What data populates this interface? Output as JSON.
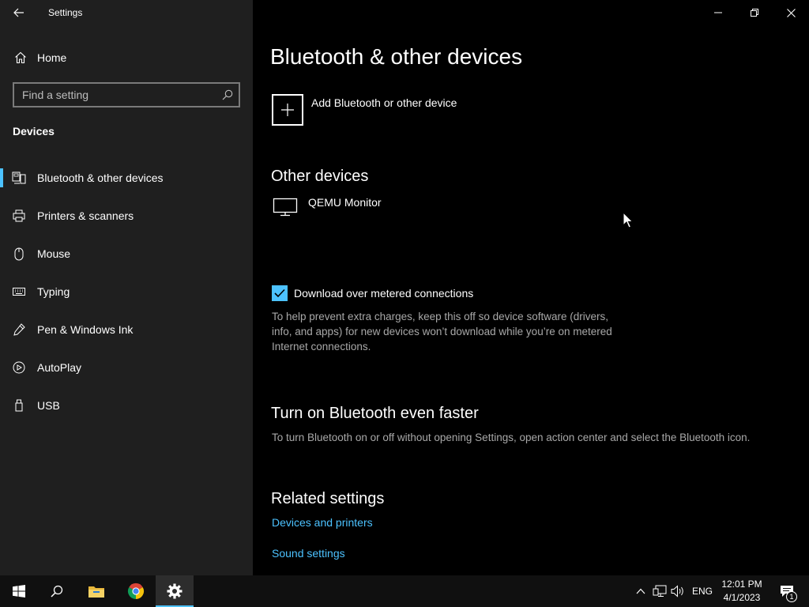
{
  "window": {
    "app_title": "Settings"
  },
  "sidebar": {
    "home_label": "Home",
    "search": {
      "placeholder": "Find a setting",
      "value": ""
    },
    "section_title": "Devices",
    "items": [
      {
        "label": "Bluetooth & other devices",
        "icon": "bluetooth-device-icon",
        "active": true
      },
      {
        "label": "Printers & scanners",
        "icon": "printer-icon"
      },
      {
        "label": "Mouse",
        "icon": "mouse-icon"
      },
      {
        "label": "Typing",
        "icon": "keyboard-icon"
      },
      {
        "label": "Pen & Windows Ink",
        "icon": "pen-icon"
      },
      {
        "label": "AutoPlay",
        "icon": "autoplay-icon"
      },
      {
        "label": "USB",
        "icon": "usb-icon"
      }
    ]
  },
  "main": {
    "title": "Bluetooth & other devices",
    "add_device_label": "Add Bluetooth or other device",
    "other_devices": {
      "heading": "Other devices",
      "devices": [
        {
          "name": "QEMU Monitor",
          "icon": "monitor-icon"
        }
      ]
    },
    "metered": {
      "label": "Download over metered connections",
      "checked": true,
      "description": "To help prevent extra charges, keep this off so device software (drivers, info, and apps) for new devices won’t download while you’re on metered Internet connections."
    },
    "faster": {
      "heading": "Turn on Bluetooth even faster",
      "description": "To turn Bluetooth on or off without opening Settings, open action center and select the Bluetooth icon."
    },
    "related": {
      "heading": "Related settings",
      "links": [
        "Devices and printers",
        "Sound settings"
      ]
    }
  },
  "taskbar": {
    "apps": [
      "start-icon",
      "search-icon",
      "file-explorer-icon",
      "chrome-icon",
      "settings-icon"
    ],
    "language": "ENG",
    "time": "12:01 PM",
    "date": "4/1/2023",
    "notification_count": "1"
  },
  "colors": {
    "accent": "#4cc2ff",
    "sidebar_bg": "#1f1f1f",
    "main_bg": "#000000",
    "taskbar_bg": "#101010"
  }
}
